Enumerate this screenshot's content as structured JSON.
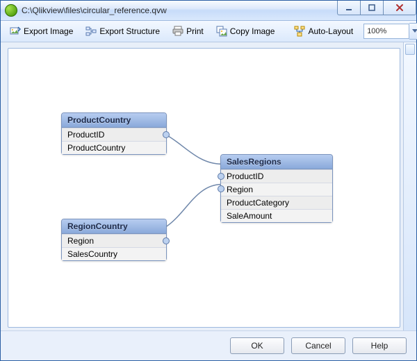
{
  "window": {
    "title": "C:\\Qlikview\\files\\circular_reference.qvw"
  },
  "toolbar": {
    "export_image": "Export Image",
    "export_structure": "Export Structure",
    "print": "Print",
    "copy_image": "Copy Image",
    "auto_layout": "Auto-Layout",
    "zoom": "100%"
  },
  "tables": {
    "productCountry": {
      "title": "ProductCountry",
      "fields": [
        "ProductID",
        "ProductCountry"
      ]
    },
    "regionCountry": {
      "title": "RegionCountry",
      "fields": [
        "Region",
        "SalesCountry"
      ]
    },
    "salesRegions": {
      "title": "SalesRegions",
      "fields": [
        "ProductID",
        "Region",
        "ProductCategory",
        "SaleAmount"
      ]
    }
  },
  "buttons": {
    "ok": "OK",
    "cancel": "Cancel",
    "help": "Help"
  }
}
